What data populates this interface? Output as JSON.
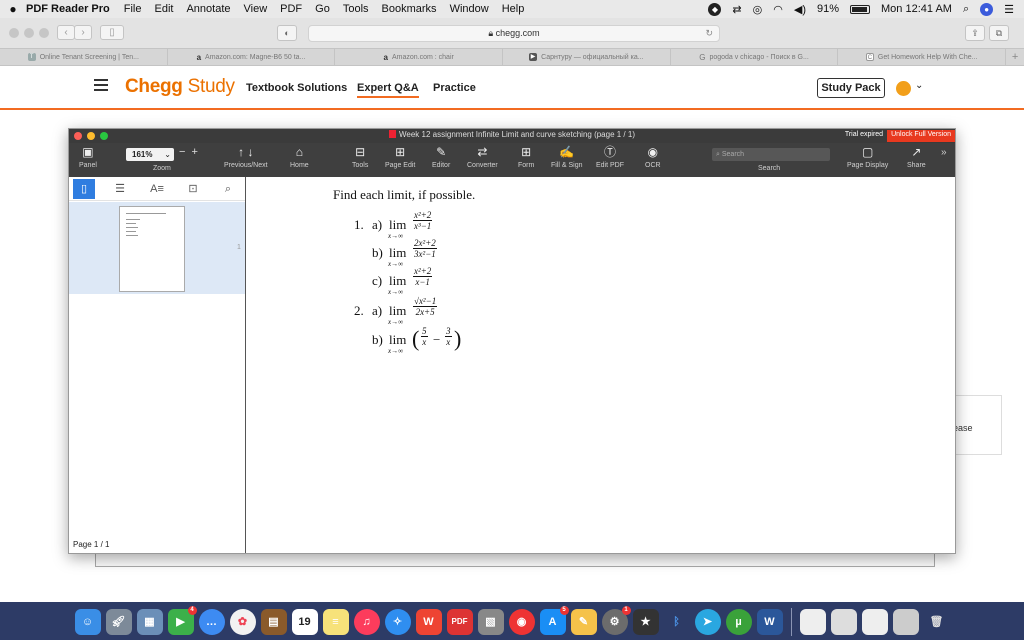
{
  "menubar": {
    "app_name": "PDF Reader Pro",
    "items": [
      "File",
      "Edit",
      "Annotate",
      "View",
      "PDF",
      "Go",
      "Tools",
      "Bookmarks",
      "Window",
      "Help"
    ],
    "battery": "91%",
    "clock": "Mon 12:41 AM"
  },
  "safari": {
    "url": "chegg.com",
    "tabs": [
      {
        "label": "Online Tenant Screening | Ten...",
        "icon": "T"
      },
      {
        "label": "Amazon.com: Magne-B6 50 ta...",
        "icon": "a"
      },
      {
        "label": "Amazon.com : chair",
        "icon": "a"
      },
      {
        "label": "Сарнтуру — официальный ка...",
        "icon": "▶"
      },
      {
        "label": "pogoda v chicago - Поиск в G...",
        "icon": "G"
      },
      {
        "label": "Get Homework Help With Che...",
        "icon": "C"
      }
    ]
  },
  "chegg": {
    "logo_brand": "Chegg",
    "logo_product": "Study",
    "nav": [
      "Textbook Solutions",
      "Expert Q&A",
      "Practice"
    ],
    "study_pack": "Study Pack",
    "bg_fragment": "ease"
  },
  "pdf": {
    "title": "Week 12 assignment Infinite Limit and curve sketching  (page 1 / 1)",
    "trial_expired": "Trial expired",
    "unlock": "Unlock Full Version",
    "zoom": "161%",
    "search_placeholder": "Search",
    "toolbar_labels": {
      "panel": "Panel",
      "zoom": "Zoom",
      "prevnext": "Previous/Next",
      "home": "Home",
      "tools": "Tools",
      "page_edit": "Page Edit",
      "editor": "Editor",
      "converter": "Converter",
      "form": "Form",
      "fill_sign": "Fill & Sign",
      "edit_pdf": "Edit PDF",
      "ocr": "OCR",
      "search": "Search",
      "page_display": "Page Display",
      "share": "Share"
    },
    "page_indicator": "Page 1 / 1",
    "thumb_page": "1",
    "document": {
      "heading": "Find each limit, if possible.",
      "problems": [
        {
          "num": "1.",
          "part": "a)",
          "lim": "lim",
          "sub": "x→∞",
          "numer": "x²+2",
          "denom": "x³−1"
        },
        {
          "num": "",
          "part": "b)",
          "lim": "lim",
          "sub": "x→∞",
          "numer": "2x²+2",
          "denom": "3x²−1"
        },
        {
          "num": "",
          "part": "c)",
          "lim": "lim",
          "sub": "x→∞",
          "numer": "x²+2",
          "denom": "x−1"
        },
        {
          "num": "2.",
          "part": "a)",
          "lim": "lim",
          "sub": "x→∞",
          "numer": "√x²−1",
          "denom": "2x+5"
        },
        {
          "num": "",
          "part": "b)",
          "lim": "lim",
          "sub": "x→∞",
          "expr_open": "(",
          "f1_num": "5",
          "f1_den": "x",
          "minus": "−",
          "f2_num": "3",
          "f2_den": "x",
          "expr_close": ")"
        }
      ]
    }
  },
  "dock": {
    "calendar_day": "19",
    "badges": {
      "mail": "4",
      "appstore": "5",
      "prefs": "1"
    }
  }
}
